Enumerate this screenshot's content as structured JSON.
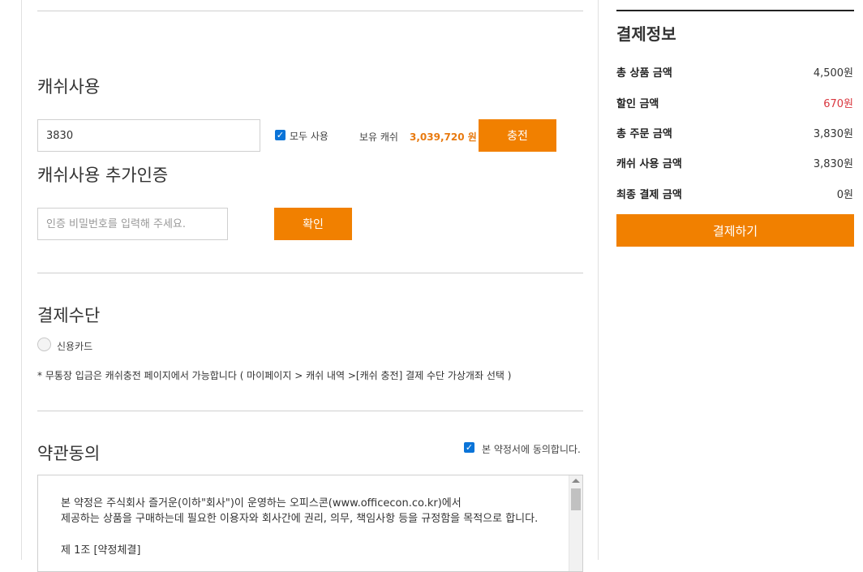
{
  "cash": {
    "title": "캐쉬사용",
    "input_value": "3830",
    "use_all_label": "모두 사용",
    "balance_label": "보유 캐쉬",
    "balance_value": "3,039,720 원",
    "charge_button": "충전"
  },
  "auth": {
    "title": "캐쉬사용 추가인증",
    "placeholder": "인증 비밀번호를 입력해 주세요.",
    "confirm_button": "확인"
  },
  "payment_method": {
    "title": "결제수단",
    "credit_card_label": "신용카드",
    "notice": "* 무통장 입금은 캐쉬충전 페이지에서 가능합니다 ( 마이페이지 > 캐쉬 내역 >[캐쉬 충전] 결제 수단 가상개좌 선택 )"
  },
  "terms": {
    "title": "약관동의",
    "agree_label": "본 약정서에 동의합니다.",
    "lines": [
      "본 약정은 주식회사 즐거운(이하\"회사\")이 운영하는 오피스콘(www.officecon.co.kr)에서",
      "제공하는 상품을 구매하는데 필요한 이용자와 회사간에 권리, 의무, 책임사항 등을 규정함을 목적으로 합니다.",
      "제 1조 [약정체결]"
    ]
  },
  "summary": {
    "title": "결제정보",
    "rows": [
      {
        "label": "총 상품 금액",
        "value": "4,500원"
      },
      {
        "label": "할인 금액",
        "value": "670원"
      },
      {
        "label": "총 주문 금액",
        "value": "3,830원"
      },
      {
        "label": "캐쉬 사용 금액",
        "value": "3,830원"
      },
      {
        "label": "최종 결제 금액",
        "value": "0원"
      }
    ],
    "pay_button": "결제하기"
  },
  "colors": {
    "accent": "#f18000",
    "discount": "#d9363e",
    "checkbox": "#0a74d8"
  }
}
